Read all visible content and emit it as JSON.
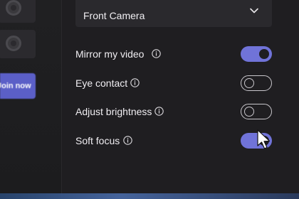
{
  "sidebar": {
    "button_label": "Join now"
  },
  "camera_dropdown": {
    "selected": "Front Camera"
  },
  "settings": [
    {
      "label": "Mirror my video",
      "enabled": true
    },
    {
      "label": "Eye contact",
      "enabled": false
    },
    {
      "label": "Adjust brightness",
      "enabled": false
    },
    {
      "label": "Soft focus",
      "enabled": true
    }
  ],
  "icons": {
    "info": "info-icon",
    "dropdown": "chevron-down-icon",
    "cursor": "mouse-pointer-icon",
    "rail_tile": "camera-tile-icon"
  },
  "colors": {
    "accent": "#7073d8",
    "button": "#5b5fc7",
    "background": "#1f1e21"
  }
}
